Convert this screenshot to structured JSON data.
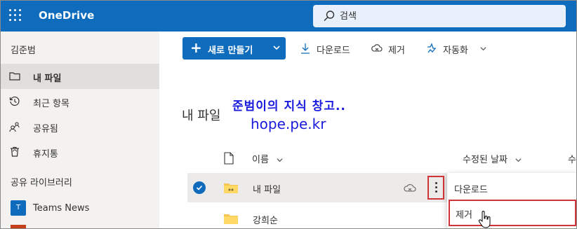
{
  "app": {
    "name": "OneDrive"
  },
  "search": {
    "placeholder": "검색"
  },
  "user": {
    "name": "김준범"
  },
  "nav": {
    "items": [
      {
        "label": "내 파일",
        "icon": "folder-icon",
        "active": true
      },
      {
        "label": "최근 항목",
        "icon": "history-icon",
        "active": false
      },
      {
        "label": "공유됨",
        "icon": "people-icon",
        "active": false
      },
      {
        "label": "휴지통",
        "icon": "trash-icon",
        "active": false
      }
    ],
    "section_label": "공유 라이브러리",
    "libraries": [
      {
        "badge": "T",
        "label": "Teams News",
        "color": "#0f6cbd"
      }
    ]
  },
  "toolbar": {
    "new_label": "새로 만들기",
    "download_label": "다운로드",
    "remove_label": "제거",
    "automate_label": "자동화"
  },
  "main": {
    "title": "내 파일",
    "watermark_line1": "준범이의 지식 창고..",
    "watermark_line2": "hope.pe.kr",
    "columns": {
      "name": "이름",
      "modified": "수정된 날짜",
      "cut": "수"
    },
    "rows": [
      {
        "name": "내 파일",
        "selected": true,
        "shared": true
      },
      {
        "name": "강희순",
        "selected": false,
        "shared": false
      }
    ]
  },
  "context_menu": {
    "items": [
      {
        "label": "다운로드"
      },
      {
        "label": "제거",
        "highlighted": true
      }
    ]
  },
  "colors": {
    "brand": "#0f6cbd",
    "highlight": "#d13438",
    "watermark": "#1a1adf"
  }
}
